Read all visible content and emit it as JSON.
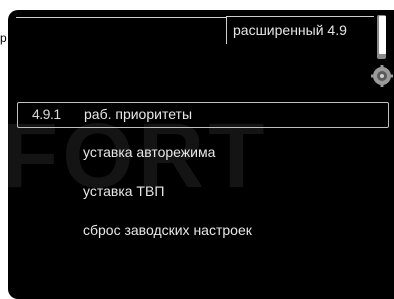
{
  "header": {
    "title": "расширенный 4.9"
  },
  "side": {
    "mark": "р"
  },
  "watermark": "FORT",
  "menu": {
    "items": [
      {
        "number": "4.9.1",
        "label": "раб. приоритеты",
        "selected": true
      },
      {
        "number": "",
        "label": "уставка авторежима",
        "selected": false
      },
      {
        "number": "",
        "label": "уставка ТВП",
        "selected": false
      },
      {
        "number": "",
        "label": "сброс заводских настроек",
        "selected": false
      }
    ]
  },
  "colors": {
    "background": "#000000",
    "text": "#e8e8e8",
    "selection_border": "#bfbfbf"
  },
  "icons": [
    "gear-icon"
  ]
}
